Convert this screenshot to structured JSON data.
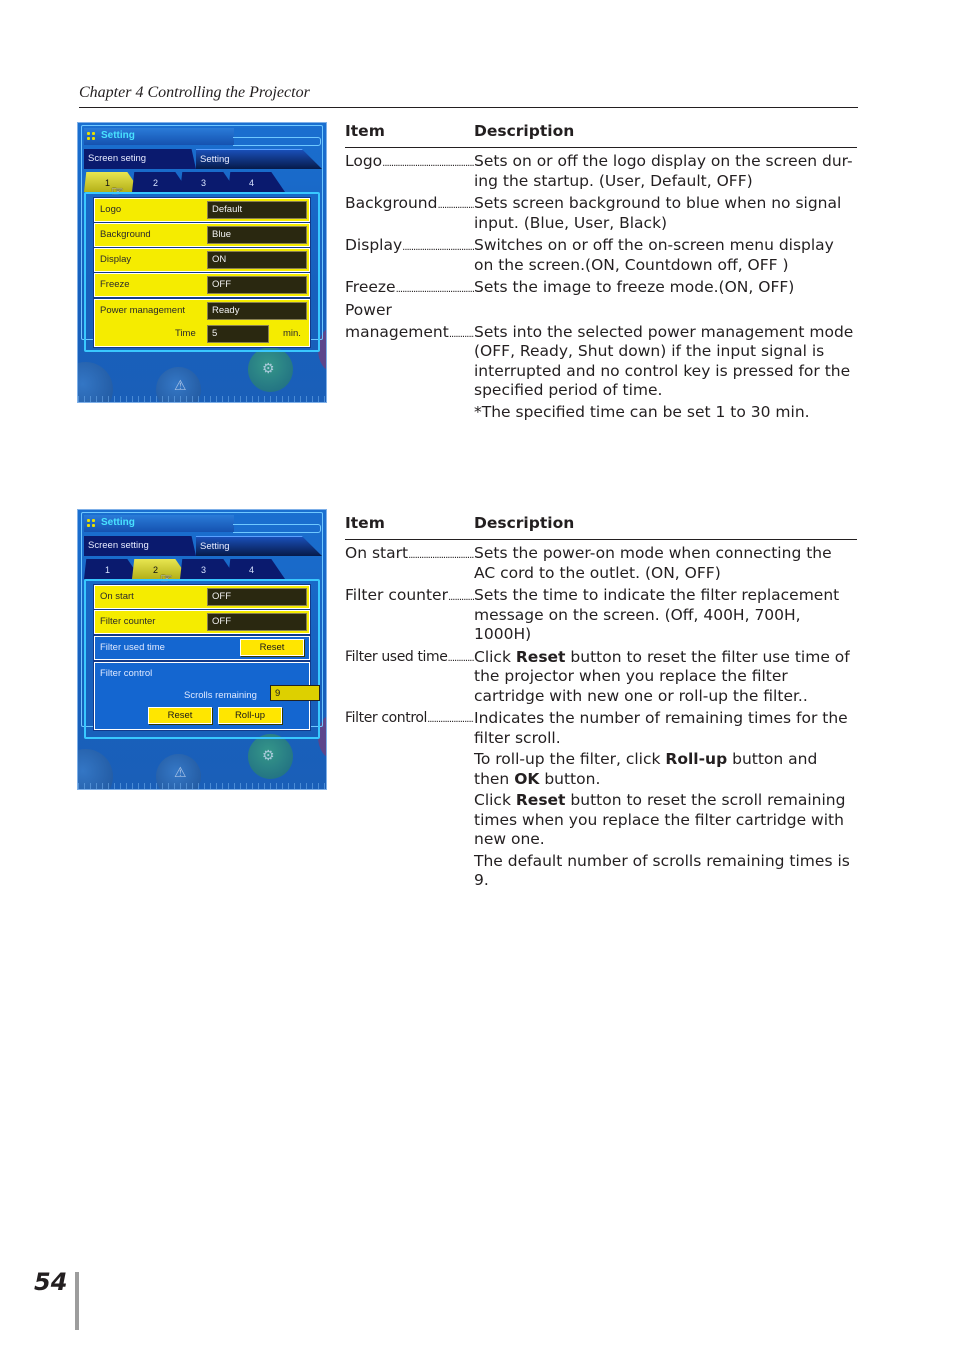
{
  "header": {
    "chapter": "Chapter 4 Controlling the Projector"
  },
  "page_number": "54",
  "colors": {
    "panel_blue": "#1760bd",
    "highlight_yellow": "#f5ec00",
    "value_dark": "#2a2810",
    "title_cyan": "#49e2ff"
  },
  "panel1": {
    "title": "Setting",
    "top_tabs": [
      "Screen seting",
      "Setting"
    ],
    "num_tabs": [
      "1",
      "2",
      "3",
      "4"
    ],
    "active_num_tab": "1",
    "rows": [
      {
        "label": "Logo",
        "value": "Default"
      },
      {
        "label": "Background",
        "value": "Blue"
      },
      {
        "label": "Display",
        "value": "ON"
      },
      {
        "label": "Freeze",
        "value": "OFF"
      }
    ],
    "power": {
      "label": "Power management",
      "value": "Ready",
      "time_label": "Time",
      "time_value": "5",
      "time_unit": "min."
    }
  },
  "panel2": {
    "title": "Setting",
    "top_tabs": [
      "Screen setting",
      "Setting"
    ],
    "num_tabs": [
      "1",
      "2",
      "3",
      "4"
    ],
    "active_num_tab": "2",
    "rows": [
      {
        "label": "On start",
        "value": "OFF"
      },
      {
        "label": "Filter counter",
        "value": "OFF"
      }
    ],
    "filter_used": {
      "label": "Filter used time",
      "button": "Reset"
    },
    "filter_control": {
      "label": "Filter control",
      "scrolls_label": "Scrolls remaining",
      "scrolls_value": "9",
      "reset_button": "Reset",
      "rollup_button": "Roll-up"
    }
  },
  "table1": {
    "headers": {
      "item": "Item",
      "description": "Description"
    },
    "rows": [
      {
        "item": "Logo",
        "desc": [
          "Sets on or off the logo display on the screen dur-ing the startup. (User, Default, OFF)"
        ]
      },
      {
        "item": "Background",
        "desc": [
          "Sets screen background to blue when no signal input. (Blue, User, Black)"
        ]
      },
      {
        "item": "Display",
        "desc": [
          "Switches on or off the on-screen menu display on the screen.(ON, Countdown off, OFF )"
        ]
      },
      {
        "item": "Freeze",
        "desc": [
          "Sets the image to freeze mode.(ON, OFF)"
        ]
      },
      {
        "item_line1": "Power",
        "item": "management",
        "desc": [
          "Sets into the selected power management mode (OFF, Ready, Shut down) if the input signal is interrupted and no control key is pressed for the specified period of time.",
          "*The specified time can be set 1 to 30 min."
        ]
      }
    ]
  },
  "table2": {
    "headers": {
      "item": "Item",
      "description": "Description"
    },
    "rows": [
      {
        "item": "On start",
        "desc": "Sets the power-on mode when connecting the AC cord to the outlet. (ON, OFF)"
      },
      {
        "item": "Filter counter",
        "desc": "Sets the time to indicate the filter replacement message on the screen. (Off, 400H, 700H, 1000H)"
      },
      {
        "item": "Filter used time",
        "desc_pre": "Click ",
        "desc_bold": "Reset",
        "desc_post": " button to reset the filter use time of the projector when you replace the filter cartridge with new one or roll-up the filter.."
      },
      {
        "item": "Filter control",
        "p1": "Indicates the number of remaining times for the filter scroll.",
        "p2_pre": "To roll-up the filter, click ",
        "p2_bold1": "Roll-up",
        "p2_mid": " button and then ",
        "p2_bold2": "OK",
        "p2_post": " button.",
        "p3_pre": "Click ",
        "p3_bold": "Reset",
        "p3_post": " button to reset the scroll remaining times when you replace the filter cartridge with new one.",
        "p4": "The default number of scrolls remaining times is 9."
      }
    ]
  }
}
